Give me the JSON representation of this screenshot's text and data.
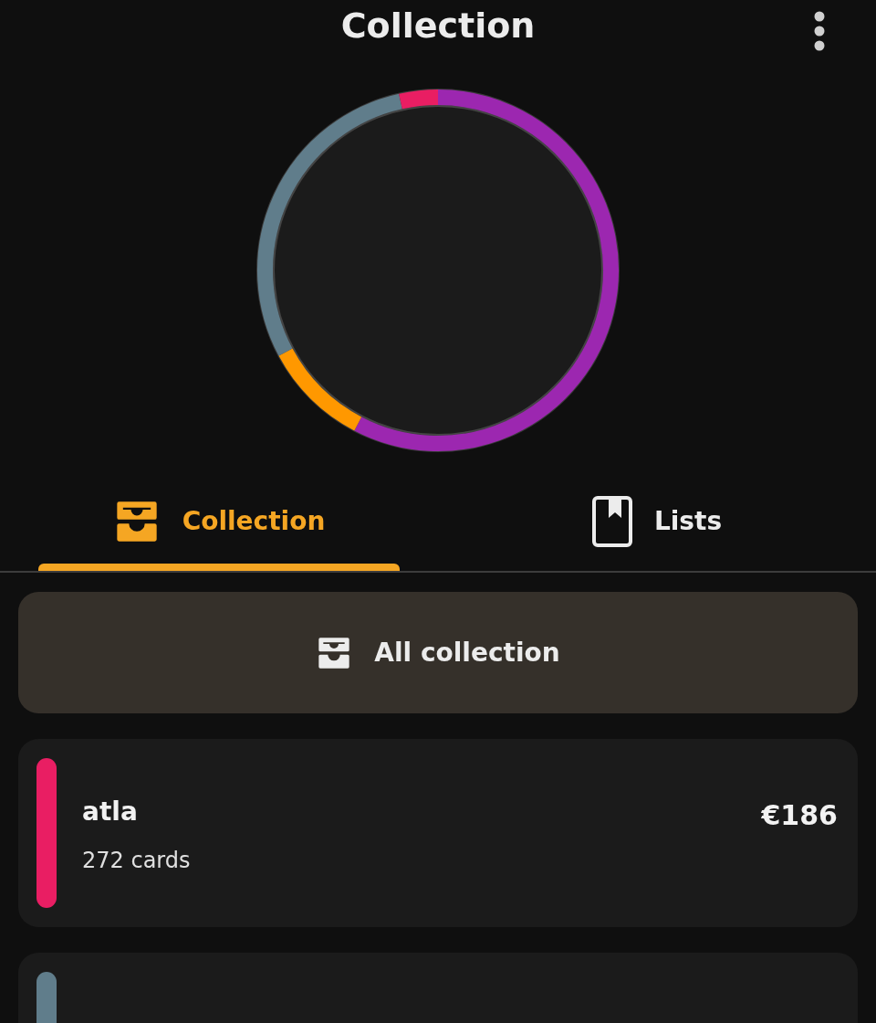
{
  "header": {
    "title": "Collection"
  },
  "tabs": [
    {
      "label": "Collection",
      "kind": "collection",
      "selected": true
    },
    {
      "label": "Lists",
      "kind": "lists",
      "selected": false
    }
  ],
  "all_collection_button": {
    "label": "All collection"
  },
  "sets": [
    {
      "name": "atla",
      "count": "272 cards",
      "value": "€186",
      "color": "#e91e63"
    },
    {
      "color": "#607d8b"
    }
  ]
}
